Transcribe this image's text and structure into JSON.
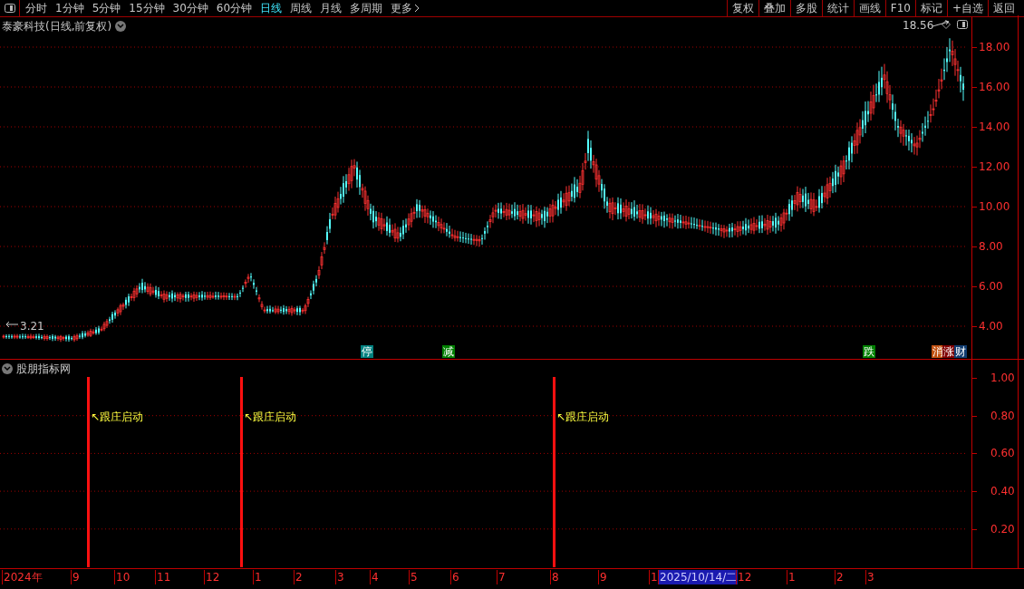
{
  "toolbar": {
    "periods": [
      {
        "label": "分时",
        "selected": false
      },
      {
        "label": "1分钟",
        "selected": false
      },
      {
        "label": "5分钟",
        "selected": false
      },
      {
        "label": "15分钟",
        "selected": false
      },
      {
        "label": "30分钟",
        "selected": false
      },
      {
        "label": "60分钟",
        "selected": false
      },
      {
        "label": "日线",
        "selected": true
      },
      {
        "label": "周线",
        "selected": false
      },
      {
        "label": "月线",
        "selected": false
      },
      {
        "label": "多周期",
        "selected": false
      }
    ],
    "more": "更多",
    "actions": [
      "复权",
      "叠加",
      "多股",
      "统计",
      "画线",
      "F10",
      "标记",
      "+自选",
      "返回"
    ]
  },
  "stock_title": "泰豪科技(日线,前复权)",
  "main_chart": {
    "high_label": "18.56",
    "low_label": "3.21",
    "price_axis": [
      "18.00",
      "16.00",
      "14.00",
      "12.00",
      "10.00",
      "8.00",
      "6.00",
      "4.00"
    ],
    "signals": [
      {
        "text": "停",
        "color": "#00807f"
      },
      {
        "text": "减",
        "color": "#008000"
      },
      {
        "text": "跌",
        "color": "#008000"
      },
      {
        "text": "消",
        "color": "#c05010"
      },
      {
        "text": "涨",
        "color": "#800000"
      },
      {
        "text": "财",
        "color": "#103c70"
      }
    ]
  },
  "indicator": {
    "title": "股朋指标网",
    "axis": [
      "1.00",
      "0.80",
      "0.60",
      "0.40",
      "0.20"
    ],
    "signals": [
      {
        "text": "↖跟庄启动"
      },
      {
        "text": "↖跟庄启动"
      },
      {
        "text": "↖跟庄启动"
      }
    ]
  },
  "time_axis": {
    "labels": [
      {
        "text": "2024年",
        "selected": false
      },
      {
        "text": "9",
        "selected": false
      },
      {
        "text": "10",
        "selected": false
      },
      {
        "text": "11",
        "selected": false
      },
      {
        "text": "12",
        "selected": false
      },
      {
        "text": "1",
        "selected": false
      },
      {
        "text": "2",
        "selected": false
      },
      {
        "text": "3",
        "selected": false
      },
      {
        "text": "4",
        "selected": false
      },
      {
        "text": "5",
        "selected": false
      },
      {
        "text": "6",
        "selected": false
      },
      {
        "text": "7",
        "selected": false
      },
      {
        "text": "8",
        "selected": false
      },
      {
        "text": "9",
        "selected": false
      },
      {
        "text": "1",
        "selected": false
      },
      {
        "text": "2025/10/14/二",
        "selected": true
      },
      {
        "text": "12",
        "selected": false
      },
      {
        "text": "1",
        "selected": false
      },
      {
        "text": "2",
        "selected": false
      },
      {
        "text": "3",
        "selected": false
      }
    ]
  }
}
